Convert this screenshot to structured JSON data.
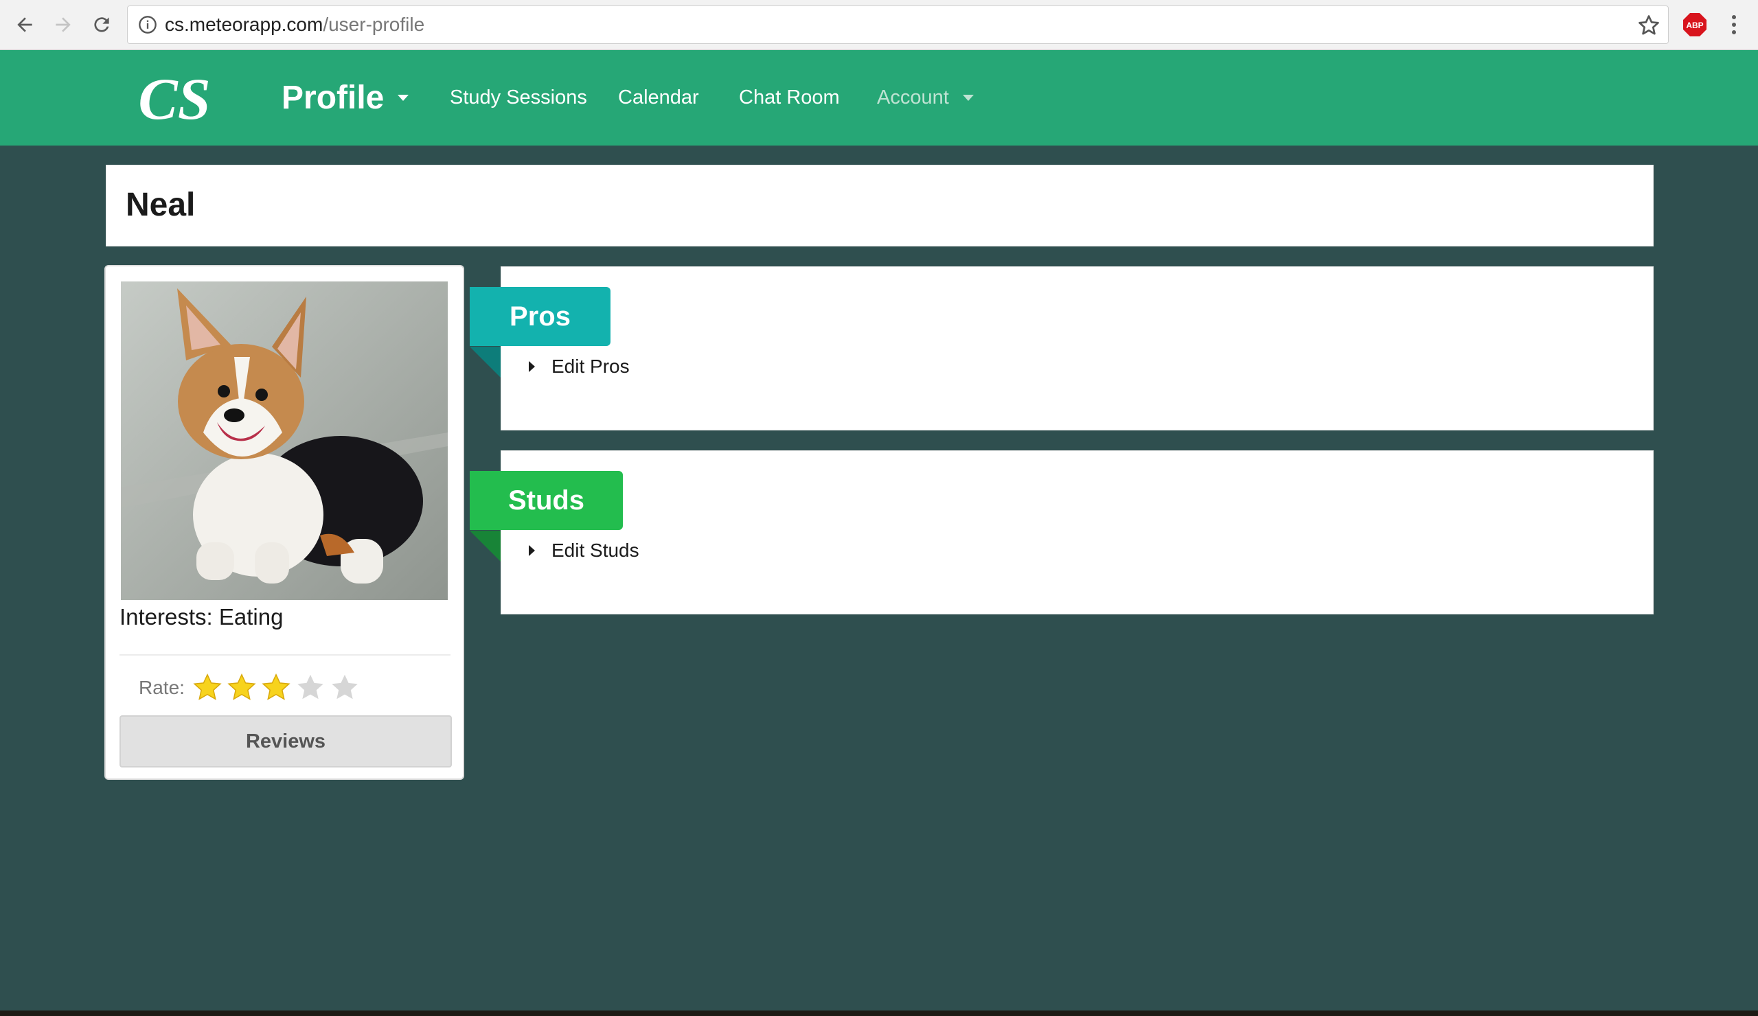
{
  "browser": {
    "url_host": "cs.meteorapp.com",
    "url_path": "/user-profile",
    "back_icon": "arrow-left-icon",
    "forward_icon": "arrow-right-icon",
    "reload_icon": "reload-icon",
    "info_icon": "info-circle-icon",
    "bookmark_icon": "star-outline-icon",
    "extension_label": "ABP",
    "menu_icon": "kebab-menu-icon"
  },
  "header": {
    "logo_text": "CS",
    "nav": {
      "profile": "Profile",
      "study_sessions": "Study Sessions",
      "calendar": "Calendar",
      "chat_room": "Chat Room",
      "account": "Account"
    }
  },
  "profile": {
    "name": "Neal",
    "photo_alt": "corgi puppy",
    "interests": "Interests: Eating",
    "rate_label": "Rate:",
    "rating": 3,
    "rating_max": 5,
    "reviews_button": "Reviews"
  },
  "sections": {
    "pros": {
      "title": "Pros",
      "edit": "Edit Pros",
      "color": "#13b2ae"
    },
    "studs": {
      "title": "Studs",
      "edit": "Edit Studs",
      "color": "#23bd4e"
    }
  },
  "colors": {
    "page_bg": "#2f4f4f",
    "header_bg": "#26a776",
    "star_filled": "#f7d31d",
    "star_empty": "#d6d6d6"
  }
}
